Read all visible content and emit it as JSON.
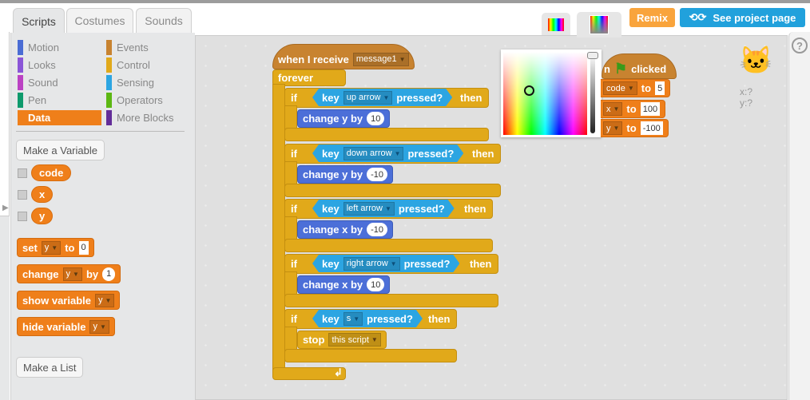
{
  "tabs": [
    {
      "label": "Scripts",
      "active": true
    },
    {
      "label": "Costumes"
    },
    {
      "label": "Sounds"
    }
  ],
  "categories": [
    {
      "label": "Motion",
      "color": "#4a6cd4"
    },
    {
      "label": "Looks",
      "color": "#8a55d7"
    },
    {
      "label": "Sound",
      "color": "#bb42c3"
    },
    {
      "label": "Pen",
      "color": "#0e9a6c"
    },
    {
      "label": "Data",
      "color": "#ee7d16",
      "active": true
    },
    {
      "label": "Events",
      "color": "#c88330"
    },
    {
      "label": "Control",
      "color": "#e1a91a"
    },
    {
      "label": "Sensing",
      "color": "#2ca5e2"
    },
    {
      "label": "Operators",
      "color": "#5cb712"
    },
    {
      "label": "More Blocks",
      "color": "#632d99"
    }
  ],
  "palette": {
    "make_variable": "Make a Variable",
    "make_list": "Make a List",
    "variables": [
      "code",
      "x",
      "y"
    ],
    "set": {
      "label": "set",
      "var": "y",
      "to": "to",
      "value": "0"
    },
    "change": {
      "label": "change",
      "var": "y",
      "by": "by",
      "value": "1"
    },
    "show": {
      "label": "show variable",
      "var": "y"
    },
    "hide": {
      "label": "hide variable",
      "var": "y"
    }
  },
  "header": {
    "remix": "Remix",
    "see_project": "See project page",
    "help": "?"
  },
  "script1": {
    "hat": "when I receive",
    "message": "message1",
    "forever": "forever",
    "ifs": [
      {
        "if": "if",
        "key": "key",
        "option": "up arrow",
        "pressed": "pressed?",
        "then": "then",
        "action": "change y by",
        "value": "10"
      },
      {
        "if": "if",
        "key": "key",
        "option": "down arrow",
        "pressed": "pressed?",
        "then": "then",
        "action": "change y by",
        "value": "-10"
      },
      {
        "if": "if",
        "key": "key",
        "option": "left arrow",
        "pressed": "pressed?",
        "then": "then",
        "action": "change x by",
        "value": "-10"
      },
      {
        "if": "if",
        "key": "key",
        "option": "right arrow",
        "pressed": "pressed?",
        "then": "then",
        "action": "change x by",
        "value": "10"
      },
      {
        "if": "if",
        "key": "key",
        "option": "s",
        "pressed": "pressed?",
        "then": "then",
        "action": "stop",
        "value": "this script"
      }
    ]
  },
  "script2": {
    "hat_prefix": "n",
    "hat_suffix": "clicked",
    "sets": [
      {
        "var": "code",
        "to": "to",
        "value": "5"
      },
      {
        "var": "x",
        "to": "to",
        "value": "100"
      },
      {
        "var": "y",
        "to": "to",
        "value": "-100"
      }
    ]
  },
  "sprite": {
    "x": "x:?",
    "y": "y:?"
  },
  "color_picker": {
    "selected_color": "#6fff6f"
  }
}
